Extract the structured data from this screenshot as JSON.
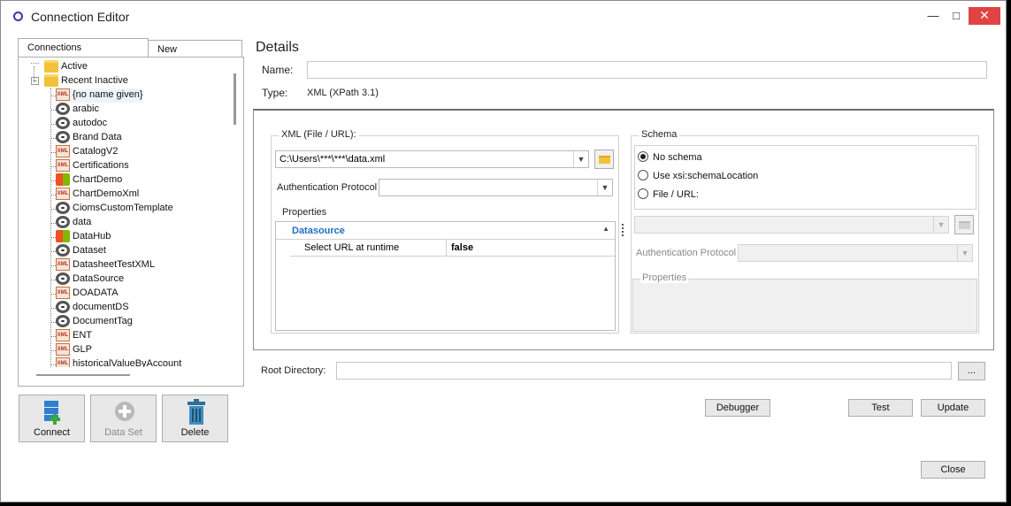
{
  "window": {
    "title": "Connection Editor",
    "minimize": "—",
    "maximize": "□",
    "close": "✕"
  },
  "tabs": {
    "connections": "Connections",
    "new": "New"
  },
  "tree": {
    "groups": [
      "Active",
      "Recent Inactive"
    ],
    "items": [
      {
        "label": "{no name given}",
        "icon": "xml-file-icon"
      },
      {
        "label": "arabic",
        "icon": "database-ring-icon"
      },
      {
        "label": "autodoc",
        "icon": "database-ring-icon"
      },
      {
        "label": "Brand Data",
        "icon": "database-ring-icon"
      },
      {
        "label": "CatalogV2",
        "icon": "xml-file-icon"
      },
      {
        "label": "Certifications",
        "icon": "xml-file-icon"
      },
      {
        "label": "ChartDemo",
        "icon": "windows-icon"
      },
      {
        "label": "ChartDemoXml",
        "icon": "xml-file-icon"
      },
      {
        "label": "CiomsCustomTemplate",
        "icon": "database-ring-icon"
      },
      {
        "label": "data",
        "icon": "database-ring-icon"
      },
      {
        "label": "DataHub",
        "icon": "windows-icon"
      },
      {
        "label": "Dataset",
        "icon": "database-ring-icon"
      },
      {
        "label": "DatasheetTestXML",
        "icon": "xml-file-icon"
      },
      {
        "label": "DataSource",
        "icon": "database-ring-icon"
      },
      {
        "label": "DOADATA",
        "icon": "xml-file-icon"
      },
      {
        "label": "documentDS",
        "icon": "database-ring-icon"
      },
      {
        "label": "DocumentTag",
        "icon": "database-ring-icon"
      },
      {
        "label": "ENT",
        "icon": "xml-file-icon"
      },
      {
        "label": "GLP",
        "icon": "xml-file-icon"
      },
      {
        "label": "historicalValueByAccount",
        "icon": "xml-file-icon"
      }
    ],
    "xml_badge": "XML"
  },
  "buttons": {
    "connect": "Connect",
    "dataset": "Data Set",
    "delete": "Delete",
    "debugger": "Debugger",
    "test": "Test",
    "update": "Update",
    "close": "Close",
    "browse": "..."
  },
  "details": {
    "heading": "Details",
    "name_label": "Name:",
    "name_value": "",
    "type_label": "Type:",
    "type_value": "XML (XPath 3.1)"
  },
  "xml": {
    "group_label": "XML (File / URL):",
    "path": "C:\\Users\\***\\***\\data.xml",
    "auth_label": "Authentication Protocol",
    "auth_value": "",
    "properties_label": "Properties",
    "prop_category": "Datasource",
    "prop_name": "Select URL at runtime",
    "prop_value": "false"
  },
  "schema": {
    "group_label": "Schema",
    "options": [
      "No schema",
      "Use xsi:schemaLocation",
      "File / URL:"
    ],
    "selected": 0,
    "auth_label": "Authentication Protocol",
    "properties_label": "Properties"
  },
  "root": {
    "label": "Root Directory:",
    "value": ""
  }
}
